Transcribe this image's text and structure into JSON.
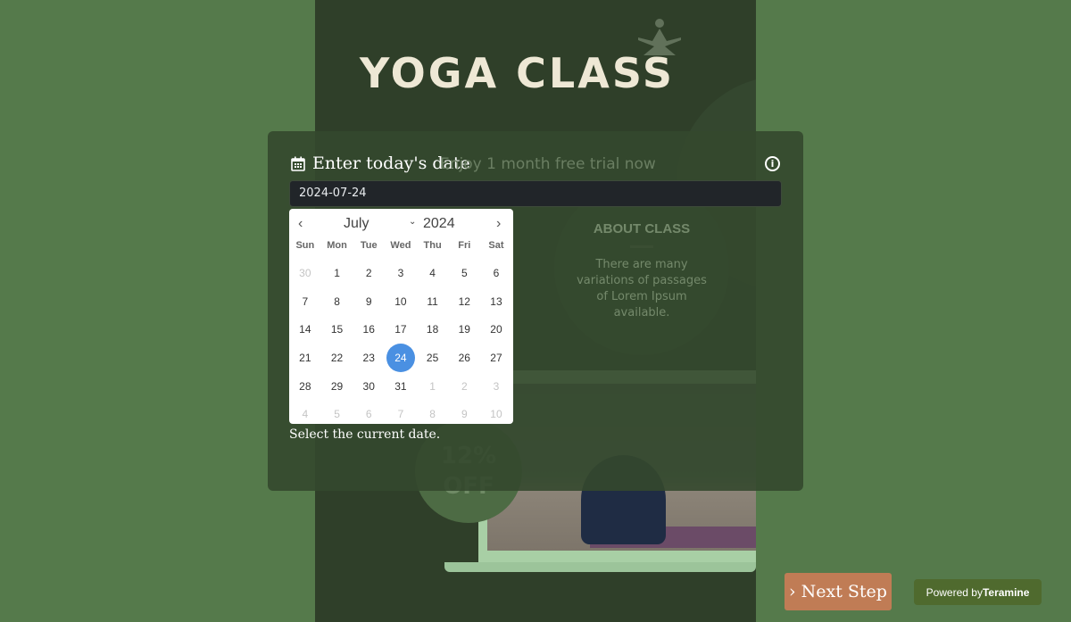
{
  "poster": {
    "title": "YOGA CLASS",
    "trial": "Enjoy 1 month free trial now",
    "about_title": "ABOUT CLASS",
    "about_text": "There are many variations of passages of Lorem Ipsum available.",
    "discount": "12% OFF"
  },
  "modal": {
    "label": "Enter today's date",
    "icon": "calendar-icon",
    "info_icon": "info-icon",
    "value": "2024-07-24",
    "hint": "Select the current date."
  },
  "calendar": {
    "month": "July",
    "year": "2024",
    "weekdays": [
      "Sun",
      "Mon",
      "Tue",
      "Wed",
      "Thu",
      "Fri",
      "Sat"
    ],
    "days": [
      [
        "30",
        1
      ],
      [
        "1",
        0
      ],
      [
        "2",
        0
      ],
      [
        "3",
        0
      ],
      [
        "4",
        0
      ],
      [
        "5",
        0
      ],
      [
        "6",
        0
      ],
      [
        "7",
        0
      ],
      [
        "8",
        0
      ],
      [
        "9",
        0
      ],
      [
        "10",
        0
      ],
      [
        "11",
        0
      ],
      [
        "12",
        0
      ],
      [
        "13",
        0
      ],
      [
        "14",
        0
      ],
      [
        "15",
        0
      ],
      [
        "16",
        0
      ],
      [
        "17",
        0
      ],
      [
        "18",
        0
      ],
      [
        "19",
        0
      ],
      [
        "20",
        0
      ],
      [
        "21",
        0
      ],
      [
        "22",
        0
      ],
      [
        "23",
        0
      ],
      [
        "24",
        2
      ],
      [
        "25",
        0
      ],
      [
        "26",
        0
      ],
      [
        "27",
        0
      ],
      [
        "28",
        0
      ],
      [
        "29",
        0
      ],
      [
        "30",
        0
      ],
      [
        "31",
        0
      ],
      [
        "1",
        1
      ],
      [
        "2",
        1
      ],
      [
        "3",
        1
      ],
      [
        "4",
        1
      ],
      [
        "5",
        1
      ],
      [
        "6",
        1
      ],
      [
        "7",
        1
      ],
      [
        "8",
        1
      ],
      [
        "9",
        1
      ],
      [
        "10",
        1
      ]
    ],
    "selected": "24",
    "selected_color": "#4a90e2"
  },
  "footer": {
    "next_label": "Next Step",
    "powered_prefix": "Powered by",
    "powered_brand": "Teramine"
  },
  "colors": {
    "background": "#557a4b",
    "next_button": "#c07c55",
    "powered_badge": "#4f6a2e"
  }
}
